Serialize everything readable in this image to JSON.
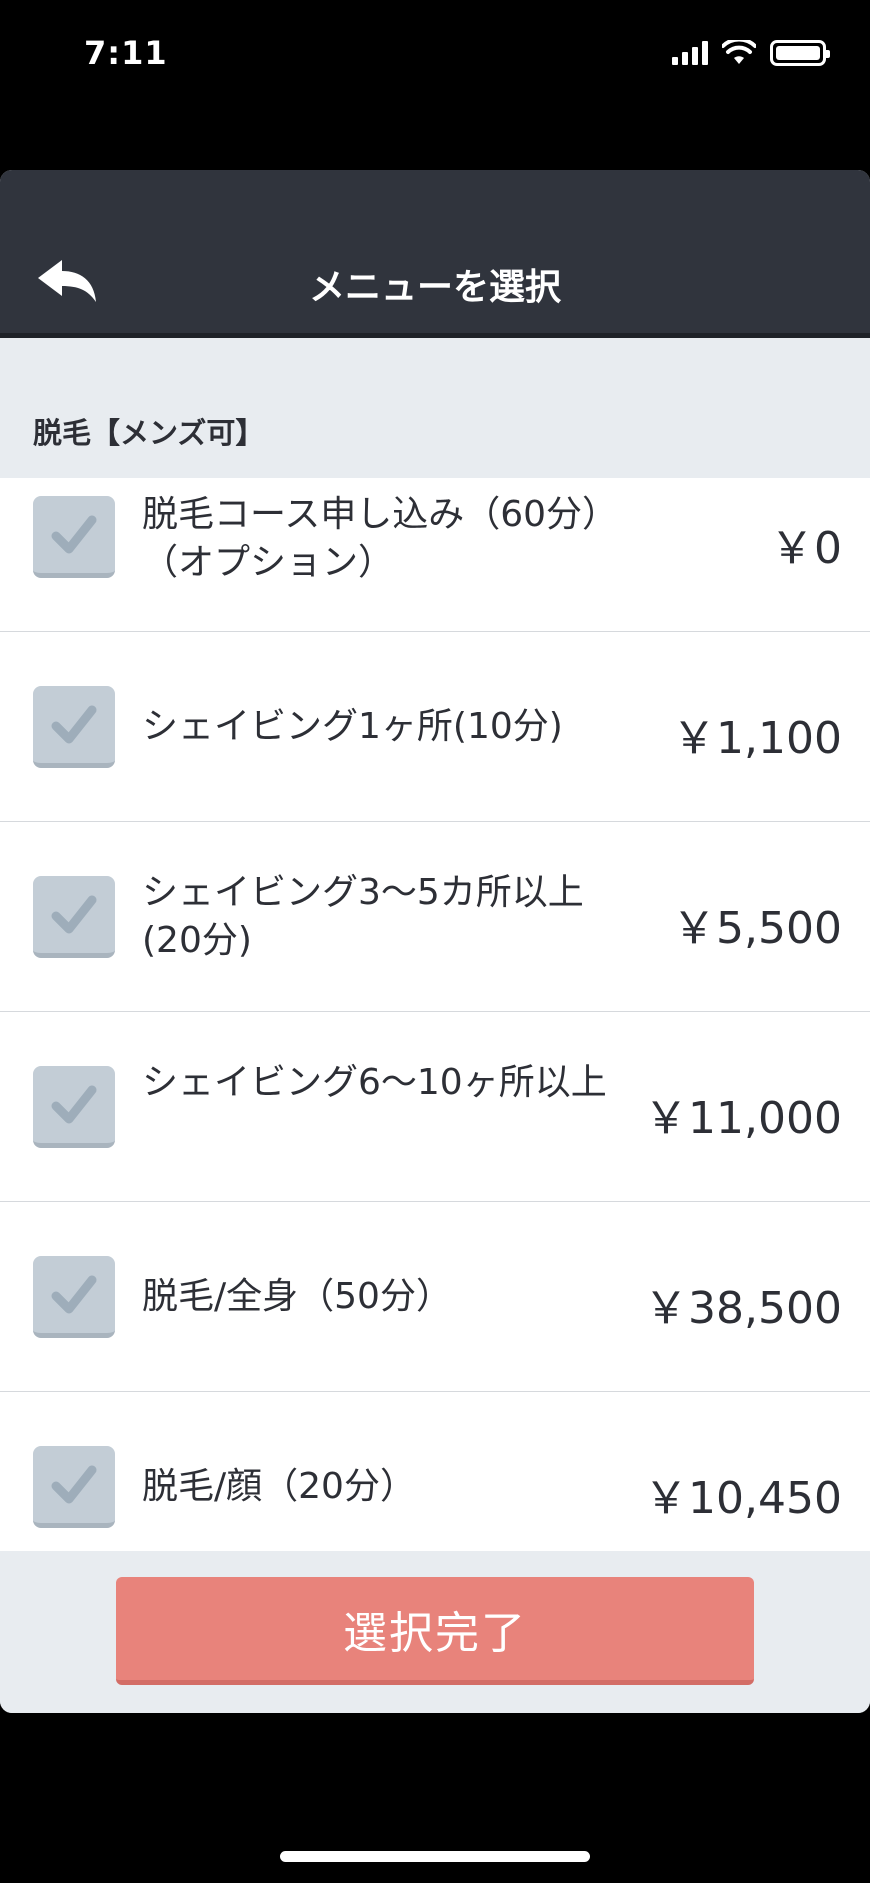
{
  "status_bar": {
    "time": "7:11"
  },
  "nav": {
    "title": "メニューを選択"
  },
  "section": {
    "title": "脱毛【メンズ可】"
  },
  "items": [
    {
      "label": "脱毛コース申し込み（60分）（オプション）",
      "price": "￥0",
      "checked": true
    },
    {
      "label": "シェイビング1ヶ所(10分)",
      "price": "￥1,100",
      "checked": true
    },
    {
      "label": "シェイビング3〜5カ所以上(20分)",
      "price": "￥5,500",
      "checked": true
    },
    {
      "label": "シェイビング6〜10ヶ所以上",
      "price": "￥11,000",
      "checked": true
    },
    {
      "label": "脱毛/全身（50分）",
      "price": "￥38,500",
      "checked": true
    },
    {
      "label": "脱毛/顔（20分）",
      "price": "￥10,450",
      "checked": true
    }
  ],
  "footer": {
    "done_label": "選択完了"
  },
  "colors": {
    "nav_bg": "#30343d",
    "accent_button": "#e8837b",
    "checkbox": "#c3cdd6"
  }
}
